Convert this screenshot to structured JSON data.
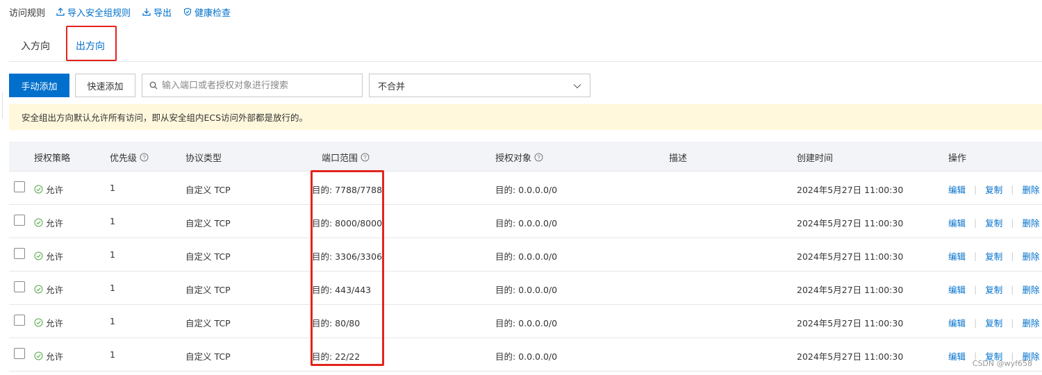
{
  "header": {
    "title": "访问规则",
    "import_label": "导入安全组规则",
    "export_label": "导出",
    "health_label": "健康检查"
  },
  "tabs": [
    {
      "label": "入方向"
    },
    {
      "label": "出方向"
    }
  ],
  "toolbar": {
    "manual_add_label": "手动添加",
    "quick_add_label": "快速添加",
    "search_placeholder": "输入端口或者授权对象进行搜索",
    "merge_select_value": "不合并"
  },
  "notice": {
    "text": "安全组出方向默认允许所有访问，即从安全组内ECS访问外部都是放行的。"
  },
  "table": {
    "columns": [
      "授权策略",
      "优先级",
      "协议类型",
      "端口范围",
      "授权对象",
      "描述",
      "创建时间",
      "操作"
    ],
    "rows": [
      {
        "policy": "允许",
        "priority": "1",
        "protocol": "自定义 TCP",
        "port": "目的: 7788/7788",
        "target": "目的: 0.0.0.0/0",
        "description": "",
        "created": "2024年5月27日 11:00:30"
      },
      {
        "policy": "允许",
        "priority": "1",
        "protocol": "自定义 TCP",
        "port": "目的: 8000/8000",
        "target": "目的: 0.0.0.0/0",
        "description": "",
        "created": "2024年5月27日 11:00:30"
      },
      {
        "policy": "允许",
        "priority": "1",
        "protocol": "自定义 TCP",
        "port": "目的: 3306/3306",
        "target": "目的: 0.0.0.0/0",
        "description": "",
        "created": "2024年5月27日 11:00:30"
      },
      {
        "policy": "允许",
        "priority": "1",
        "protocol": "自定义 TCP",
        "port": "目的: 443/443",
        "target": "目的: 0.0.0.0/0",
        "description": "",
        "created": "2024年5月27日 11:00:30"
      },
      {
        "policy": "允许",
        "priority": "1",
        "protocol": "自定义 TCP",
        "port": "目的: 80/80",
        "target": "目的: 0.0.0.0/0",
        "description": "",
        "created": "2024年5月27日 11:00:30"
      },
      {
        "policy": "允许",
        "priority": "1",
        "protocol": "自定义 TCP",
        "port": "目的: 22/22",
        "target": "目的: 0.0.0.0/0",
        "description": "",
        "created": "2024年5月27日 11:00:30"
      }
    ],
    "actions": {
      "edit": "编辑",
      "copy": "复制",
      "delete": "删除"
    }
  },
  "watermark": "CSDN @wyf658",
  "colors": {
    "accent": "#0070cc",
    "highlight": "#e3231c",
    "notice_bg": "#fff8dc",
    "allow": "#52a845"
  }
}
